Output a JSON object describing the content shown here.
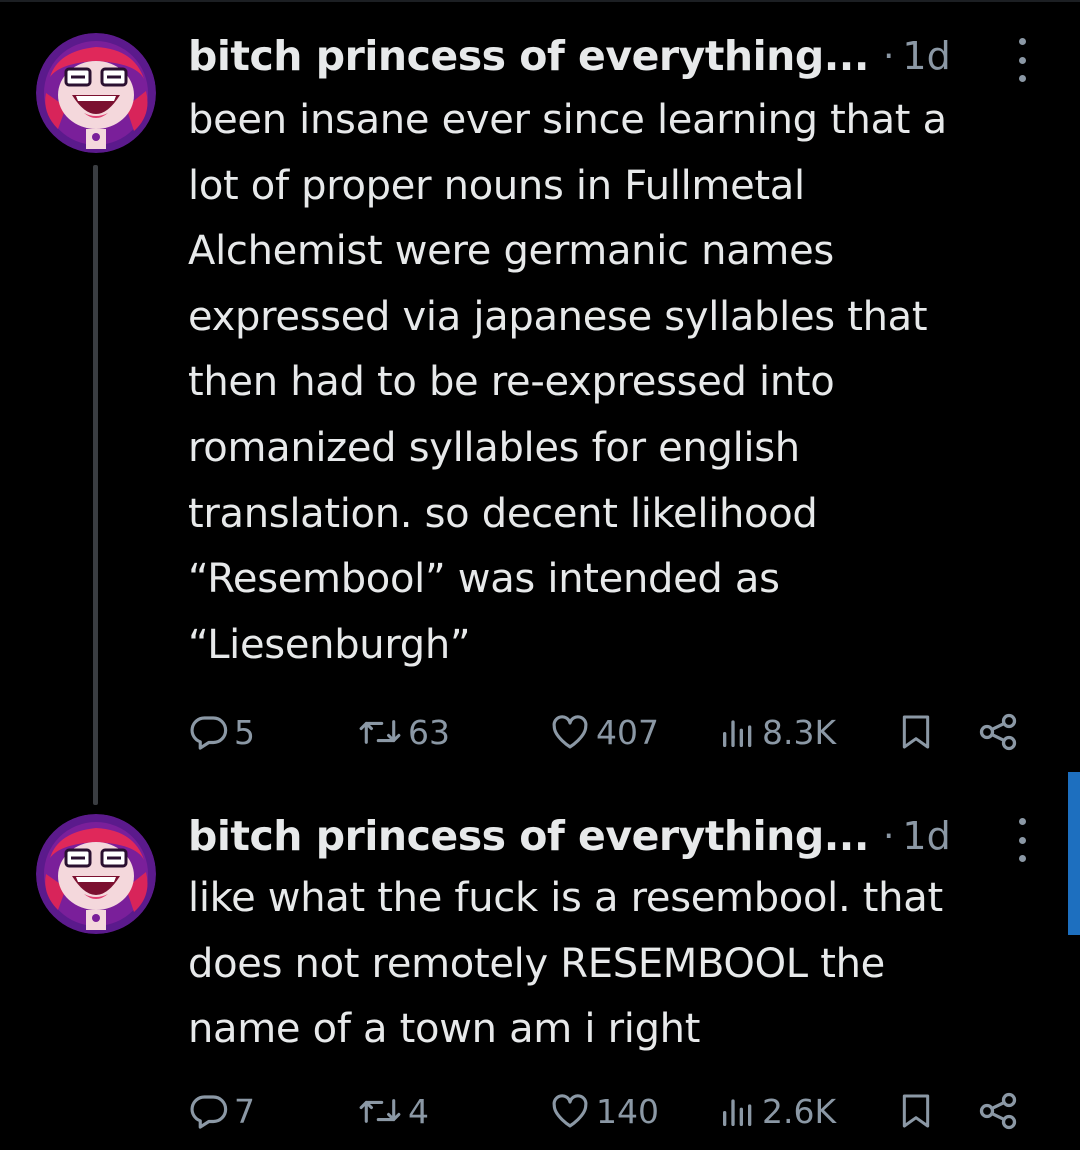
{
  "tweets": [
    {
      "author": "bitch princess of everything...",
      "separator": "·",
      "time": "1d",
      "more_icon": "more-vertical-icon",
      "lines": [
        "been insane ever since learning that a",
        "lot of proper nouns in Fullmetal",
        "Alchemist were germanic names",
        "expressed via japanese syllables that",
        "then had to be re-expressed into",
        "romanized syllables for english",
        "translation. so decent likelihood",
        "“Resembool” was intended as",
        "“Liesenburgh”"
      ],
      "replies": "5",
      "reposts": "63",
      "likes": "407",
      "views": "8.3K"
    },
    {
      "author": "bitch princess of everything...",
      "separator": "·",
      "time": "1d",
      "more_icon": "more-vertical-icon",
      "lines": [
        "like what the fuck is a resembool. that",
        "does not remotely RESEMBOOL the",
        "name of a town am i right"
      ],
      "replies": "7",
      "reposts": "4",
      "likes": "140",
      "views": "2.6K"
    }
  ],
  "icons": {
    "reply": "reply-bubble-icon",
    "repost": "repost-icon",
    "like": "heart-icon",
    "views": "views-bar-chart-icon",
    "bookmark": "bookmark-icon",
    "share": "share-icon"
  },
  "colors": {
    "background": "#000000",
    "text": "#e7e9ea",
    "muted": "#8b98a5",
    "thread_line": "#3a3d41",
    "scrollbar": "#1d6fbf"
  }
}
